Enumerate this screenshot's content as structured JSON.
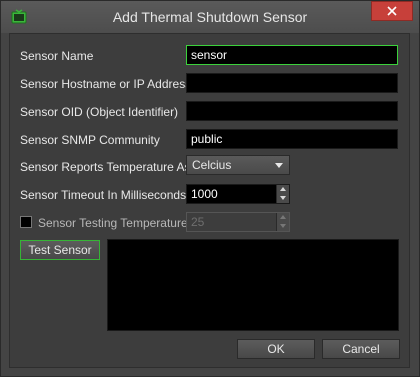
{
  "window": {
    "title": "Add Thermal Shutdown Sensor",
    "icon": "monitor-icon",
    "accent_color": "#3bd13b",
    "close_color": "#c7403a"
  },
  "form": {
    "sensor_name": {
      "label": "Sensor Name",
      "value": "sensor"
    },
    "hostname": {
      "label": "Sensor Hostname or IP Address",
      "value": ""
    },
    "oid": {
      "label": "Sensor OID (Object Identifier)",
      "value": ""
    },
    "snmp_community": {
      "label": "Sensor SNMP Community",
      "value": "public"
    },
    "temperature_unit": {
      "label": "Sensor Reports Temperature As",
      "value": "Celcius"
    },
    "timeout": {
      "label": "Sensor Timeout In Milliseconds",
      "value": "1000"
    },
    "testing_temperature": {
      "label": "Sensor Testing Temperature",
      "value": "25",
      "checked": false
    }
  },
  "buttons": {
    "test_sensor": "Test Sensor",
    "ok": "OK",
    "cancel": "Cancel"
  }
}
